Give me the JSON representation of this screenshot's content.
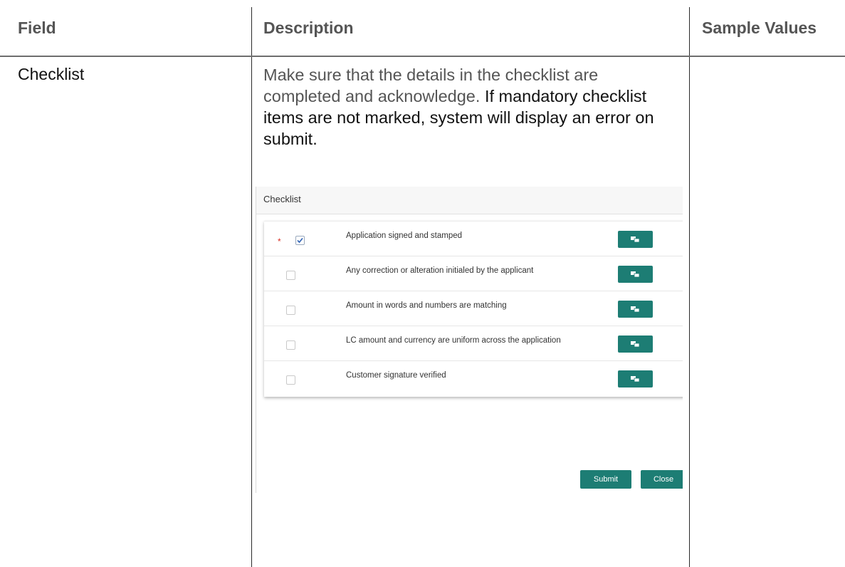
{
  "table": {
    "headers": [
      "Field",
      "Description",
      "Sample Values"
    ],
    "row": {
      "field": "Checklist",
      "description_part1": "Make sure that the details in the checklist are completed and acknowledge.",
      "description_part2": "If mandatory checklist items are not marked, system will display an error on submit."
    }
  },
  "screenshot": {
    "title": "Checklist",
    "items": [
      {
        "label": "Application signed and stamped",
        "checked": true,
        "mandatory": true
      },
      {
        "label": "Any correction or alteration initialed by the applicant",
        "checked": false,
        "mandatory": false
      },
      {
        "label": "Amount in words and numbers are matching",
        "checked": false,
        "mandatory": false
      },
      {
        "label": "LC amount and currency are uniform across the application",
        "checked": false,
        "mandatory": false
      },
      {
        "label": "Customer signature verified",
        "checked": false,
        "mandatory": false
      }
    ],
    "mandatory_marker": "*",
    "item_button_icon": "comment-icon",
    "submit_label": "Submit",
    "close_label": "Close",
    "accent_color": "#1d7d74"
  }
}
